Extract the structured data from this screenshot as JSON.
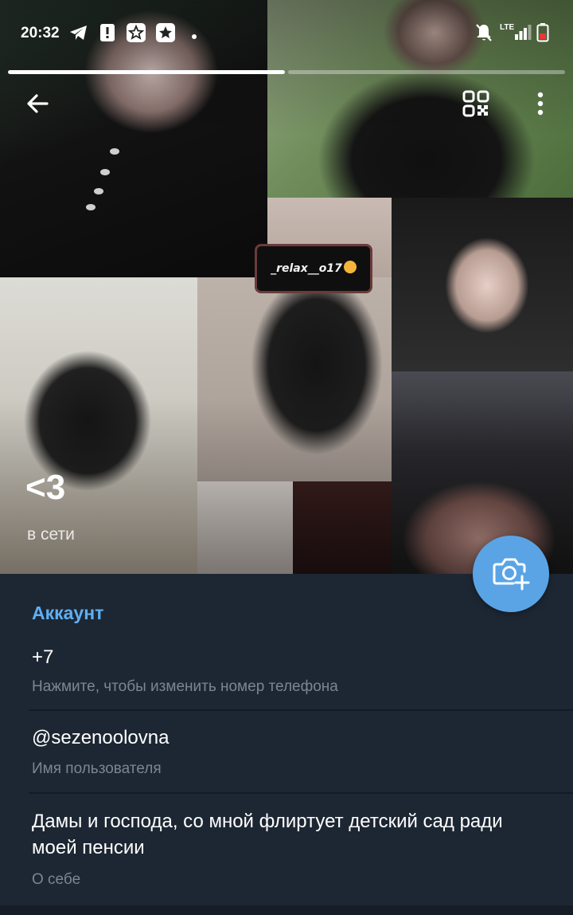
{
  "status_bar": {
    "time": "20:32",
    "network": "LTE"
  },
  "stories": {
    "progress": [
      1.0,
      0.0
    ]
  },
  "hero": {
    "phone_label": "_relax__o17"
  },
  "profile": {
    "name": "<3",
    "status": "в сети"
  },
  "account": {
    "section_title": "Аккаунт",
    "phone": {
      "value": "+7",
      "label": "Нажмите, чтобы изменить номер телефона"
    },
    "username": {
      "value": "@sezenoolovna",
      "label": "Имя пользователя"
    },
    "bio": {
      "value": "Дамы и господа, со мной флиртует детский сад ради моей пенсии",
      "label": "О себе"
    }
  },
  "icons": {
    "back": "arrow-left-icon",
    "qr": "qr-code-icon",
    "menu": "more-vertical-icon",
    "camera": "add-photo-icon"
  },
  "colors": {
    "background": "#1d2733",
    "accent": "#5fb0f2",
    "fab": "#5aa4e6",
    "secondary_text": "#7b8692"
  }
}
